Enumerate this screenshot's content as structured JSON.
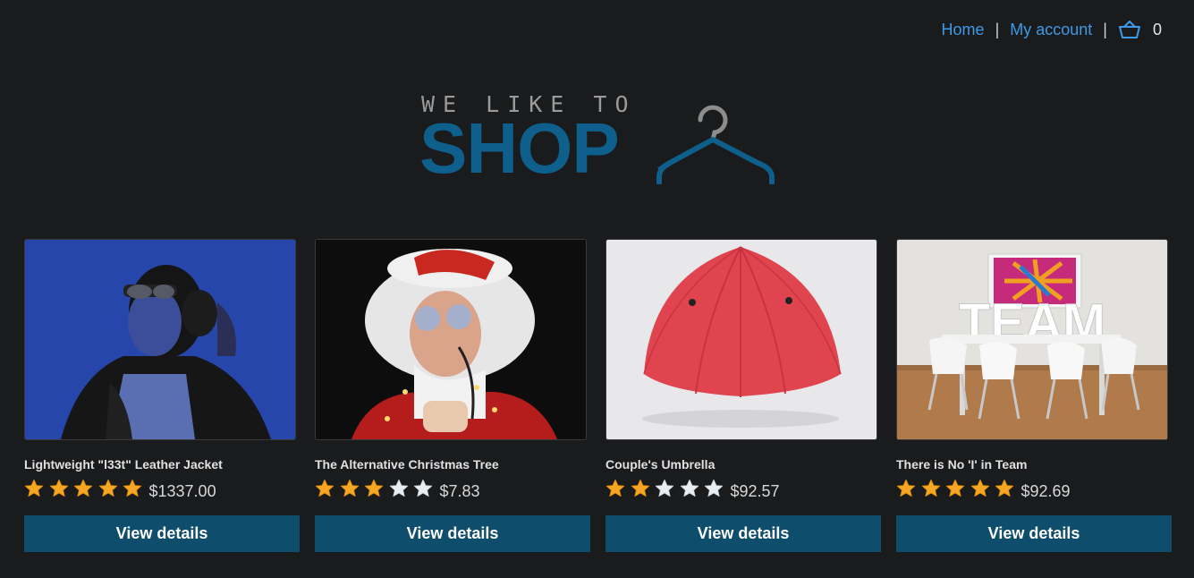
{
  "nav": {
    "home": "Home",
    "separator": "|",
    "my_account": "My account",
    "cart_count": "0"
  },
  "logo": {
    "top_text": "WE LIKE TO",
    "main_text": "SHOP"
  },
  "colors": {
    "background": "#1a1b1d",
    "link": "#3d9ae8",
    "brand": "#0f5f8d",
    "button": "#0e4d6b",
    "star_filled": "#f5a623",
    "star_empty": "#e8eef2"
  },
  "products": [
    {
      "title": "Lightweight \"l33t\" Leather Jacket",
      "rating": 5,
      "price": "$1337.00",
      "button": "View details",
      "image": "woman-headphones-photo"
    },
    {
      "title": "The Alternative Christmas Tree",
      "rating": 3,
      "price": "$7.83",
      "button": "View details",
      "image": "man-in-santa-wig-with-lights-photo"
    },
    {
      "title": "Couple's Umbrella",
      "rating": 2,
      "price": "$92.57",
      "button": "View details",
      "image": "red-double-umbrella-photo"
    },
    {
      "title": "There is No 'I' in Team",
      "rating": 5,
      "price": "$92.69",
      "button": "View details",
      "image": "team-meeting-room-photo"
    }
  ]
}
